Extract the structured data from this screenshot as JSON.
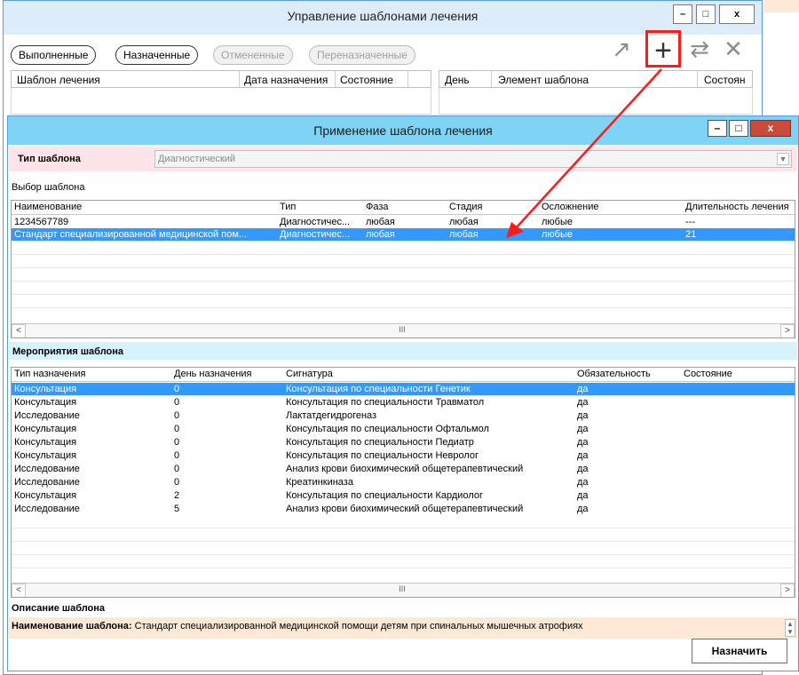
{
  "background_window": {
    "title": "Управление шаблонами лечения",
    "window_buttons": {
      "minimize": "–",
      "maximize": "□",
      "close": "x"
    },
    "filters": [
      {
        "label": "Выполненные",
        "enabled": true
      },
      {
        "label": "Назначенные",
        "enabled": true
      },
      {
        "label": "Отмененные",
        "enabled": false
      },
      {
        "label": "Переназначенные",
        "enabled": false
      }
    ],
    "toolbar": {
      "export": "↗",
      "add": "+",
      "swap": "⇄",
      "remove": "✕"
    },
    "left_table_headers": [
      "Шаблон лечения",
      "Дата назначения",
      "Состояние"
    ],
    "right_table_headers": [
      "День",
      "Элемент шаблона",
      "Состоян"
    ]
  },
  "dialog": {
    "title": "Применение шаблона лечения",
    "window_buttons": {
      "minimize": "–",
      "maximize": "□",
      "close": "x"
    },
    "template_type_label": "Тип шаблона",
    "template_type_value": "Диагностический",
    "template_selection_label": "Выбор шаблона",
    "templates_table": {
      "columns": [
        "Наименование",
        "Тип",
        "Фаза",
        "Стадия",
        "Осложнение",
        "Длительность лечения"
      ],
      "rows": [
        [
          "1234567789",
          "Диагностичес...",
          "любая",
          "любая",
          "любые",
          "---"
        ],
        [
          "Стандарт специализированной медицинской пом...",
          "Диагностичес...",
          "любая",
          "любая",
          "любые",
          "21"
        ]
      ],
      "selected_row": 1,
      "scroll_thumb": "III"
    },
    "activities_label": "Мероприятия шаблона",
    "activities_table": {
      "columns": [
        "Тип назначения",
        "День назначения",
        "Сигнатура",
        "Обязательность",
        "Состояние"
      ],
      "rows": [
        [
          "Консультация",
          "0",
          "Консультация по специальности Генетик",
          "да",
          ""
        ],
        [
          "Консультация",
          "0",
          "Консультация по специальности Травматол",
          "да",
          ""
        ],
        [
          "Исследование",
          "0",
          "Лактатдегидрогеназ",
          "да",
          ""
        ],
        [
          "Консультация",
          "0",
          "Консультация по специальности Офтальмол",
          "да",
          ""
        ],
        [
          "Консультация",
          "0",
          "Консультация по специальности Педиатр",
          "да",
          ""
        ],
        [
          "Консультация",
          "0",
          "Консультация по специальности Невролог",
          "да",
          ""
        ],
        [
          "Исследование",
          "0",
          "Анализ крови биохимический общетерапевтический",
          "да",
          ""
        ],
        [
          "Исследование",
          "0",
          "Креатинкиназа",
          "да",
          ""
        ],
        [
          "Консультация",
          "2",
          "Консультация по специальности Кардиолог",
          "да",
          ""
        ],
        [
          "Исследование",
          "5",
          "Анализ крови биохимический общетерапевтический",
          "да",
          ""
        ]
      ],
      "selected_row": 0,
      "scroll_thumb": "III"
    },
    "description_label": "Описание шаблона",
    "description_name_label": "Наименование шаблона:",
    "description_name_value": "Стандарт специализированной медицинской помощи детям при спинальных мышечных атрофиях",
    "assign_button": "Назначить"
  },
  "colors": {
    "dialog_titlebar": "#7fd3f4",
    "selection": "#3399ff",
    "annotation": "#ff1a1a",
    "type_row_bg": "#fde4e8",
    "description_bg": "#fde9d6"
  }
}
